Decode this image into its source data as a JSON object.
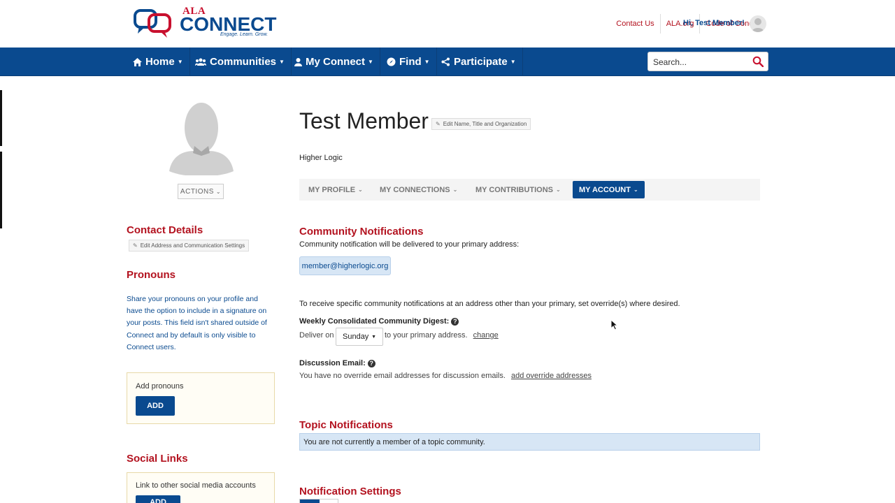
{
  "header": {
    "logo_ala": "ALA",
    "logo_connect": "CONNECT",
    "logo_tagline": "Engage. Learn. Grow.",
    "links": [
      "Contact Us",
      "ALA.org",
      "Code of Conduct"
    ],
    "greeting": "Hi, Test Member!"
  },
  "nav": {
    "items": [
      {
        "label": "Home",
        "icon": "home-icon"
      },
      {
        "label": "Communities",
        "icon": "people-icon"
      },
      {
        "label": "My Connect",
        "icon": "person-icon"
      },
      {
        "label": "Find",
        "icon": "compass-icon"
      },
      {
        "label": "Participate",
        "icon": "share-icon"
      }
    ],
    "search_placeholder": "Search..."
  },
  "left": {
    "actions_label": "ACTIONS",
    "contact_title": "Contact Details",
    "contact_edit": "Edit Address and Communication Settings",
    "pronouns_title": "Pronouns",
    "pronouns_text": "Share your pronouns on your profile and have the option to include in a signature on your posts. This field isn't shared outside of Connect and by default is only visible to Connect users.",
    "add_pronouns_label": "Add pronouns",
    "add_button": "ADD",
    "social_title": "Social Links",
    "social_text": "Link to other social media accounts"
  },
  "main": {
    "name": "Test Member",
    "edit_name": "Edit Name, Title and Organization",
    "organization": "Higher Logic",
    "tabs": [
      {
        "label": "MY PROFILE",
        "active": false
      },
      {
        "label": "MY CONNECTIONS",
        "active": false
      },
      {
        "label": "MY CONTRIBUTIONS",
        "active": false
      },
      {
        "label": "MY ACCOUNT",
        "active": true
      }
    ],
    "community_title": "Community Notifications",
    "community_intro": "Community notification will be delivered to your primary address:",
    "primary_email": "member@higherlogic.org",
    "override_text": "To receive specific community notifications at an address other than your primary, set override(s) where desired.",
    "digest_label": "Weekly Consolidated Community Digest:",
    "deliver_on": "Deliver on",
    "digest_day": "Sunday",
    "to_primary": "to your primary address.",
    "change_link": "change",
    "discussion_label": "Discussion Email:",
    "discussion_text": "You have no override email addresses for discussion emails.",
    "add_override_link": "add override addresses",
    "topic_title": "Topic Notifications",
    "topic_info": "You are not currently a member of a topic community.",
    "settings_title": "Notification Settings"
  },
  "colors": {
    "brand_blue": "#0a4a8f",
    "brand_red": "#b3121f",
    "info_blue": "#d7e6f5"
  }
}
